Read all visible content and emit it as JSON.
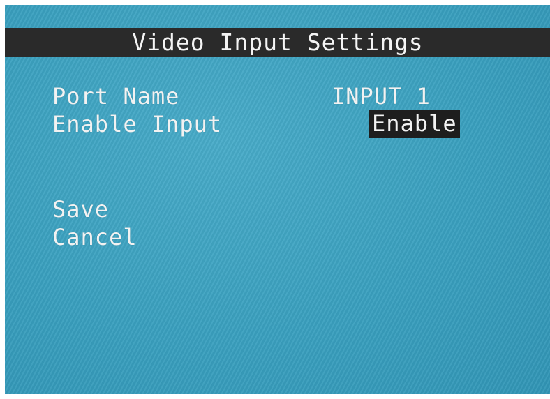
{
  "screen": {
    "title": "Video Input Settings",
    "background_color": "#3a9fbe",
    "title_bar_color": "#2a2a2a",
    "highlight_color": "#1e1e1e"
  },
  "settings": {
    "port_name_label": "Port Name",
    "port_name_value": "INPUT 1",
    "enable_input_label": "Enable Input",
    "enable_input_value": "Enable"
  },
  "menu": {
    "save_label": "Save",
    "cancel_label": "Cancel"
  }
}
